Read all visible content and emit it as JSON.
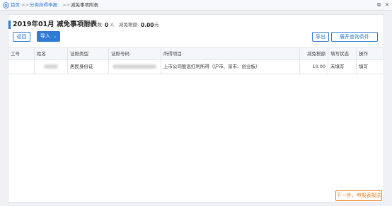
{
  "breadcrumb": {
    "home": "首页",
    "sep1": ">>",
    "level2": "分类所得申报",
    "sep2": ">>",
    "current": "减免事项附表"
  },
  "window": {
    "restore": "⧉",
    "close": "✕"
  },
  "header": {
    "title": "2019年01月 减免事项附表",
    "filled_label": "填写人数:",
    "filled_count": "0",
    "filled_unit": "人",
    "tax_label": "减免税额:",
    "tax_value": "0.00",
    "tax_unit": "元"
  },
  "toolbar": {
    "back": "返回",
    "import": "导入",
    "export": "导出",
    "expand_filter": "展开查询条件"
  },
  "table": {
    "columns": [
      "工号",
      "姓名",
      "证照类型",
      "证照号码",
      "所得项目",
      "减免税额",
      "填写状态",
      "操作"
    ],
    "rows": [
      {
        "id": "",
        "name": "",
        "cert_type": "居民身份证",
        "cert_no": "",
        "income_item": "上市公司股息红利所得（沪市、深市、创业板）",
        "reduction": "10.00",
        "status": "未填写",
        "action": "填写"
      }
    ]
  },
  "footer": {
    "next": "下一步，申报表报送"
  },
  "colors": {
    "accent": "#2e7ad6",
    "next": "#e8812a"
  }
}
